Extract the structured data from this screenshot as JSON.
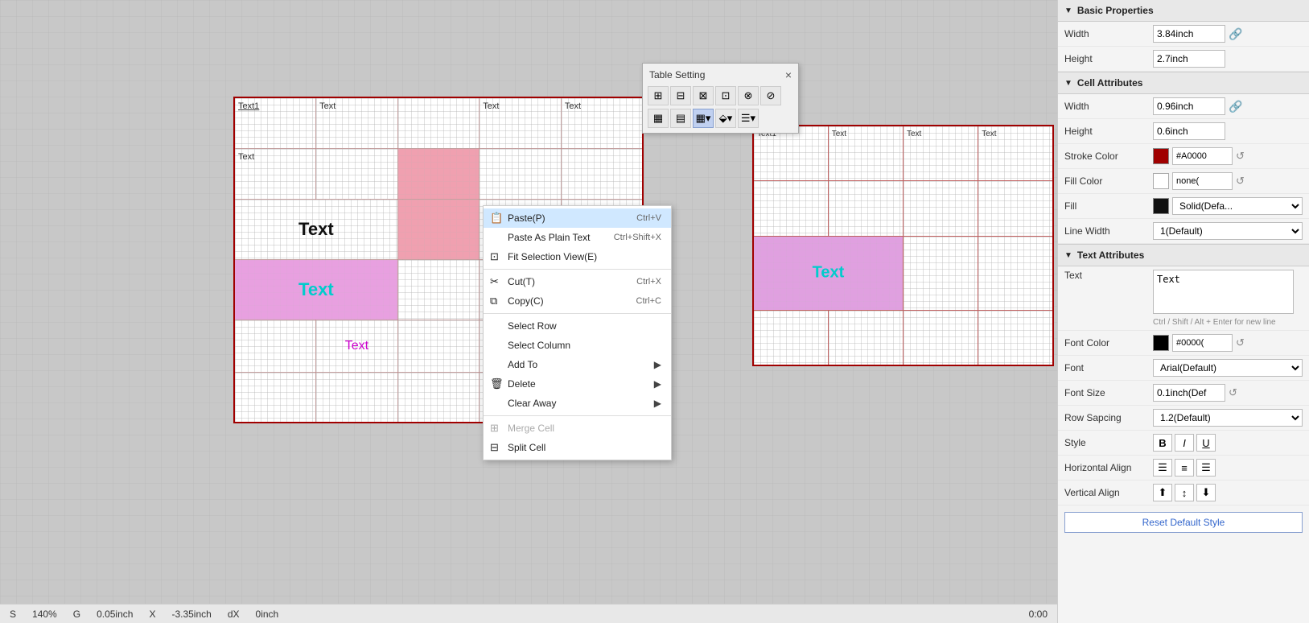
{
  "canvas": {
    "background": "#c8c8c8"
  },
  "table_setting": {
    "title": "Table Setting",
    "close_label": "×"
  },
  "context_menu": {
    "items": [
      {
        "id": "paste",
        "label": "Paste(P)",
        "shortcut": "Ctrl+V",
        "icon": "📋",
        "has_arrow": false,
        "active": true,
        "disabled": false
      },
      {
        "id": "paste_plain",
        "label": "Paste As Plain Text",
        "shortcut": "Ctrl+Shift+X",
        "icon": "",
        "has_arrow": false,
        "active": false,
        "disabled": false
      },
      {
        "id": "fit_selection",
        "label": "Fit Selection View(E)",
        "shortcut": "",
        "icon": "⊡",
        "has_arrow": false,
        "active": false,
        "disabled": false
      },
      {
        "id": "sep1",
        "type": "separator"
      },
      {
        "id": "cut",
        "label": "Cut(T)",
        "shortcut": "Ctrl+X",
        "icon": "✂",
        "has_arrow": false,
        "active": false,
        "disabled": false
      },
      {
        "id": "copy",
        "label": "Copy(C)",
        "shortcut": "Ctrl+C",
        "icon": "⧉",
        "has_arrow": false,
        "active": false,
        "disabled": false
      },
      {
        "id": "sep2",
        "type": "separator"
      },
      {
        "id": "select_row",
        "label": "Select Row",
        "shortcut": "",
        "icon": "",
        "has_arrow": false,
        "active": false,
        "disabled": false
      },
      {
        "id": "select_col",
        "label": "Select Column",
        "shortcut": "",
        "icon": "",
        "has_arrow": false,
        "active": false,
        "disabled": false
      },
      {
        "id": "add_to",
        "label": "Add To",
        "shortcut": "",
        "icon": "",
        "has_arrow": true,
        "active": false,
        "disabled": false
      },
      {
        "id": "delete",
        "label": "Delete",
        "shortcut": "",
        "icon": "🗑",
        "has_arrow": true,
        "active": false,
        "disabled": false
      },
      {
        "id": "clear_away",
        "label": "Clear Away",
        "shortcut": "",
        "icon": "",
        "has_arrow": true,
        "active": false,
        "disabled": false
      },
      {
        "id": "sep3",
        "type": "separator"
      },
      {
        "id": "merge_cell",
        "label": "Merge Cell",
        "shortcut": "",
        "icon": "⊞",
        "has_arrow": false,
        "active": false,
        "disabled": true
      },
      {
        "id": "split_cell",
        "label": "Split Cell",
        "shortcut": "",
        "icon": "⊟",
        "has_arrow": false,
        "active": false,
        "disabled": false
      }
    ]
  },
  "right_panel": {
    "basic_properties_title": "Basic Properties",
    "width_label": "Width",
    "width_value": "3.84inch",
    "height_label": "Height",
    "height_value": "2.7inch",
    "cell_attributes_title": "Cell Attributes",
    "cell_width_label": "Width",
    "cell_width_value": "0.96inch",
    "cell_height_label": "Height",
    "cell_height_value": "0.6inch",
    "stroke_color_label": "Stroke Color",
    "stroke_color_hex": "#A0000",
    "stroke_color_swatch": "#a00000",
    "fill_color_label": "Fill Color",
    "fill_color_hex": "none(",
    "fill_color_swatch": "#ffffff",
    "fill_label": "Fill",
    "fill_value": "Solid(Defa...",
    "line_width_label": "Line Width",
    "line_width_value": "1(Default)",
    "text_attributes_title": "Text Attributes",
    "text_label": "Text",
    "text_value": "Text",
    "text_hint": "Ctrl / Shift / Alt + Enter for new line",
    "font_color_label": "Font Color",
    "font_color_hex": "#0000(",
    "font_color_swatch": "#000000",
    "font_label": "Font",
    "font_value": "Arial(Default)",
    "font_size_label": "Font Size",
    "font_size_value": "0.1inch(Def",
    "row_spacing_label": "Row Sapcing",
    "row_spacing_value": "1.2(Default)",
    "style_label": "Style",
    "style_bold": "B",
    "style_italic": "I",
    "style_underline": "U",
    "h_align_label": "Horizontal Align",
    "v_align_label": "Vertical Align",
    "reset_btn_label": "Reset Default Style"
  },
  "status_bar": {
    "scale_label": "S",
    "scale_value": "140%",
    "g_label": "G",
    "g_value": "0.05inch",
    "x_label": "X",
    "x_value": "-3.35inch",
    "dx_label": "dX",
    "dx_value": "0inch",
    "time": "0:00"
  },
  "table1": {
    "cells": [
      [
        "Text1",
        "Text",
        "",
        "Text",
        "Text"
      ],
      [
        "Text",
        "",
        "",
        "",
        ""
      ],
      [
        "Text",
        "",
        "",
        "",
        ""
      ],
      [
        "Text",
        "",
        "",
        "",
        ""
      ],
      [
        "",
        "",
        "",
        "",
        ""
      ]
    ]
  }
}
